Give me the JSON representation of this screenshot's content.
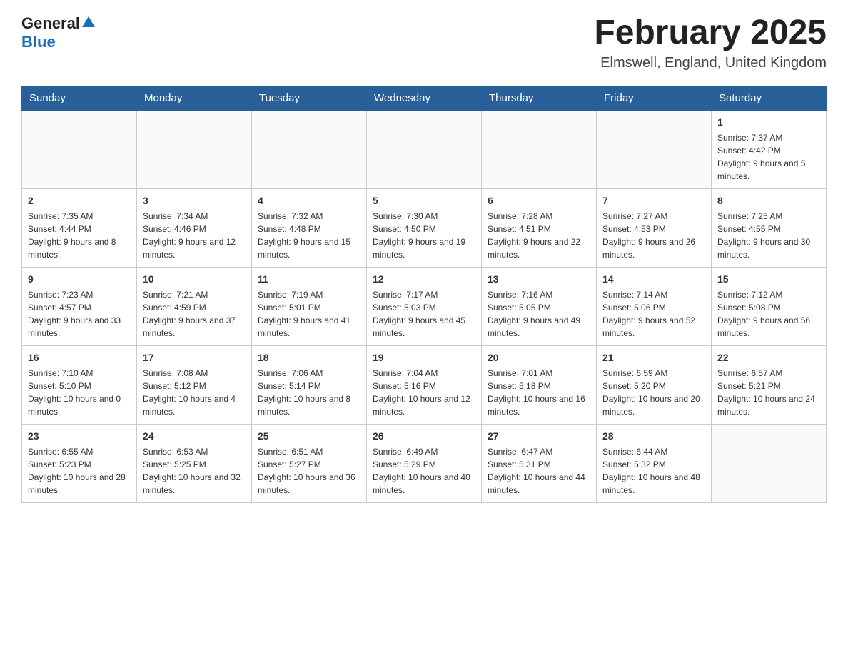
{
  "header": {
    "logo": {
      "general": "General",
      "blue": "Blue"
    },
    "month_title": "February 2025",
    "location": "Elmswell, England, United Kingdom"
  },
  "days_of_week": [
    "Sunday",
    "Monday",
    "Tuesday",
    "Wednesday",
    "Thursday",
    "Friday",
    "Saturday"
  ],
  "weeks": [
    [
      {
        "day": "",
        "sunrise": "",
        "sunset": "",
        "daylight": ""
      },
      {
        "day": "",
        "sunrise": "",
        "sunset": "",
        "daylight": ""
      },
      {
        "day": "",
        "sunrise": "",
        "sunset": "",
        "daylight": ""
      },
      {
        "day": "",
        "sunrise": "",
        "sunset": "",
        "daylight": ""
      },
      {
        "day": "",
        "sunrise": "",
        "sunset": "",
        "daylight": ""
      },
      {
        "day": "",
        "sunrise": "",
        "sunset": "",
        "daylight": ""
      },
      {
        "day": "1",
        "sunrise": "Sunrise: 7:37 AM",
        "sunset": "Sunset: 4:42 PM",
        "daylight": "Daylight: 9 hours and 5 minutes."
      }
    ],
    [
      {
        "day": "2",
        "sunrise": "Sunrise: 7:35 AM",
        "sunset": "Sunset: 4:44 PM",
        "daylight": "Daylight: 9 hours and 8 minutes."
      },
      {
        "day": "3",
        "sunrise": "Sunrise: 7:34 AM",
        "sunset": "Sunset: 4:46 PM",
        "daylight": "Daylight: 9 hours and 12 minutes."
      },
      {
        "day": "4",
        "sunrise": "Sunrise: 7:32 AM",
        "sunset": "Sunset: 4:48 PM",
        "daylight": "Daylight: 9 hours and 15 minutes."
      },
      {
        "day": "5",
        "sunrise": "Sunrise: 7:30 AM",
        "sunset": "Sunset: 4:50 PM",
        "daylight": "Daylight: 9 hours and 19 minutes."
      },
      {
        "day": "6",
        "sunrise": "Sunrise: 7:28 AM",
        "sunset": "Sunset: 4:51 PM",
        "daylight": "Daylight: 9 hours and 22 minutes."
      },
      {
        "day": "7",
        "sunrise": "Sunrise: 7:27 AM",
        "sunset": "Sunset: 4:53 PM",
        "daylight": "Daylight: 9 hours and 26 minutes."
      },
      {
        "day": "8",
        "sunrise": "Sunrise: 7:25 AM",
        "sunset": "Sunset: 4:55 PM",
        "daylight": "Daylight: 9 hours and 30 minutes."
      }
    ],
    [
      {
        "day": "9",
        "sunrise": "Sunrise: 7:23 AM",
        "sunset": "Sunset: 4:57 PM",
        "daylight": "Daylight: 9 hours and 33 minutes."
      },
      {
        "day": "10",
        "sunrise": "Sunrise: 7:21 AM",
        "sunset": "Sunset: 4:59 PM",
        "daylight": "Daylight: 9 hours and 37 minutes."
      },
      {
        "day": "11",
        "sunrise": "Sunrise: 7:19 AM",
        "sunset": "Sunset: 5:01 PM",
        "daylight": "Daylight: 9 hours and 41 minutes."
      },
      {
        "day": "12",
        "sunrise": "Sunrise: 7:17 AM",
        "sunset": "Sunset: 5:03 PM",
        "daylight": "Daylight: 9 hours and 45 minutes."
      },
      {
        "day": "13",
        "sunrise": "Sunrise: 7:16 AM",
        "sunset": "Sunset: 5:05 PM",
        "daylight": "Daylight: 9 hours and 49 minutes."
      },
      {
        "day": "14",
        "sunrise": "Sunrise: 7:14 AM",
        "sunset": "Sunset: 5:06 PM",
        "daylight": "Daylight: 9 hours and 52 minutes."
      },
      {
        "day": "15",
        "sunrise": "Sunrise: 7:12 AM",
        "sunset": "Sunset: 5:08 PM",
        "daylight": "Daylight: 9 hours and 56 minutes."
      }
    ],
    [
      {
        "day": "16",
        "sunrise": "Sunrise: 7:10 AM",
        "sunset": "Sunset: 5:10 PM",
        "daylight": "Daylight: 10 hours and 0 minutes."
      },
      {
        "day": "17",
        "sunrise": "Sunrise: 7:08 AM",
        "sunset": "Sunset: 5:12 PM",
        "daylight": "Daylight: 10 hours and 4 minutes."
      },
      {
        "day": "18",
        "sunrise": "Sunrise: 7:06 AM",
        "sunset": "Sunset: 5:14 PM",
        "daylight": "Daylight: 10 hours and 8 minutes."
      },
      {
        "day": "19",
        "sunrise": "Sunrise: 7:04 AM",
        "sunset": "Sunset: 5:16 PM",
        "daylight": "Daylight: 10 hours and 12 minutes."
      },
      {
        "day": "20",
        "sunrise": "Sunrise: 7:01 AM",
        "sunset": "Sunset: 5:18 PM",
        "daylight": "Daylight: 10 hours and 16 minutes."
      },
      {
        "day": "21",
        "sunrise": "Sunrise: 6:59 AM",
        "sunset": "Sunset: 5:20 PM",
        "daylight": "Daylight: 10 hours and 20 minutes."
      },
      {
        "day": "22",
        "sunrise": "Sunrise: 6:57 AM",
        "sunset": "Sunset: 5:21 PM",
        "daylight": "Daylight: 10 hours and 24 minutes."
      }
    ],
    [
      {
        "day": "23",
        "sunrise": "Sunrise: 6:55 AM",
        "sunset": "Sunset: 5:23 PM",
        "daylight": "Daylight: 10 hours and 28 minutes."
      },
      {
        "day": "24",
        "sunrise": "Sunrise: 6:53 AM",
        "sunset": "Sunset: 5:25 PM",
        "daylight": "Daylight: 10 hours and 32 minutes."
      },
      {
        "day": "25",
        "sunrise": "Sunrise: 6:51 AM",
        "sunset": "Sunset: 5:27 PM",
        "daylight": "Daylight: 10 hours and 36 minutes."
      },
      {
        "day": "26",
        "sunrise": "Sunrise: 6:49 AM",
        "sunset": "Sunset: 5:29 PM",
        "daylight": "Daylight: 10 hours and 40 minutes."
      },
      {
        "day": "27",
        "sunrise": "Sunrise: 6:47 AM",
        "sunset": "Sunset: 5:31 PM",
        "daylight": "Daylight: 10 hours and 44 minutes."
      },
      {
        "day": "28",
        "sunrise": "Sunrise: 6:44 AM",
        "sunset": "Sunset: 5:32 PM",
        "daylight": "Daylight: 10 hours and 48 minutes."
      },
      {
        "day": "",
        "sunrise": "",
        "sunset": "",
        "daylight": ""
      }
    ]
  ]
}
